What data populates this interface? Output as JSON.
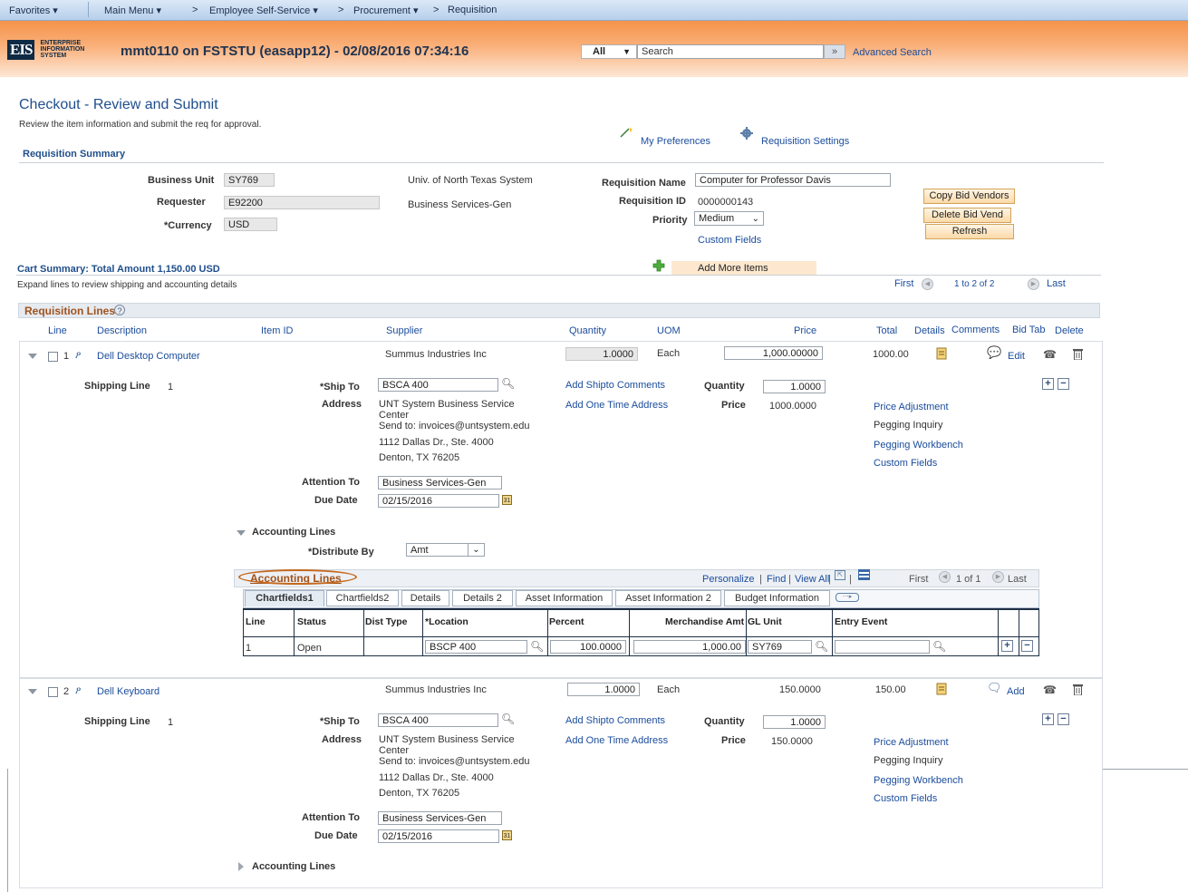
{
  "nav": {
    "favorites": "Favorites",
    "main_menu": "Main Menu",
    "employee_self_service": "Employee Self-Service",
    "procurement": "Procurement",
    "requisition": "Requisition"
  },
  "header": {
    "logo_text": "EIS",
    "logo_line1": "ENTERPRISE",
    "logo_line2": "INFORMATION",
    "logo_line3": "SYSTEM",
    "title": "mmt0110 on FSTSTU (easapp12) - 02/08/2016 07:34:16",
    "search_scope": "All",
    "search_placeholder": "Search",
    "advanced_search": "Advanced Search"
  },
  "page": {
    "title": "Checkout - Review and Submit",
    "instructions": "Review the item information and submit the req for approval.",
    "my_preferences": "My Preferences",
    "requisition_settings": "Requisition Settings",
    "summary_heading": "Requisition Summary"
  },
  "summary": {
    "business_unit_label": "Business Unit",
    "business_unit": "SY769",
    "business_unit_desc": "Univ. of North Texas System",
    "requester_label": "Requester",
    "requester": "E92200",
    "requester_desc": "Business Services-Gen",
    "currency_label": "*Currency",
    "currency": "USD",
    "req_name_label": "Requisition Name",
    "req_name": "Computer for Professor Davis",
    "req_id_label": "Requisition ID",
    "req_id": "0000000143",
    "priority_label": "Priority",
    "priority": "Medium",
    "custom_fields": "Custom Fields",
    "copy_bid_vendors": "Copy Bid Vendors",
    "delete_bid_vendors": "Delete Bid Vend",
    "refresh": "Refresh"
  },
  "cart": {
    "summary": "Cart Summary: Total Amount 1,150.00 USD",
    "expand_note": "Expand lines to review shipping and accounting details",
    "add_more_items": "Add More Items",
    "first": "First",
    "range": "1 to 2 of 2",
    "last": "Last"
  },
  "req_lines": {
    "heading": "Requisition Lines",
    "columns": {
      "line": "Line",
      "description": "Description",
      "item_id": "Item ID",
      "supplier": "Supplier",
      "quantity": "Quantity",
      "uom": "UOM",
      "price": "Price",
      "total": "Total",
      "details": "Details",
      "comments": "Comments",
      "bid_tab": "Bid Tab",
      "delete": "Delete"
    },
    "lines": [
      {
        "num": "1",
        "description": "Dell Desktop Computer",
        "supplier": "Summus Industries Inc",
        "quantity": "1.0000",
        "uom": "Each",
        "price": "1,000.00000",
        "total": "1000.00",
        "comment_action": "Edit",
        "shipping_line_label": "Shipping Line",
        "shipping_line": "1",
        "ship_to_label": "*Ship To",
        "ship_to": "BSCA 400",
        "address_label": "Address",
        "address_1": "UNT System Business Service",
        "address_2": "Center",
        "address_3": "Send to: invoices@untsystem.edu",
        "address_4": "1112 Dallas Dr., Ste. 4000",
        "address_5": "Denton, TX  76205",
        "add_shipto_comments": "Add Shipto Comments",
        "add_one_time_address": "Add One Time Address",
        "ship_qty_label": "Quantity",
        "ship_qty": "1.0000",
        "ship_price_label": "Price",
        "ship_price": "1000.0000",
        "price_adjustment": "Price Adjustment",
        "pegging_inquiry": "Pegging Inquiry",
        "pegging_workbench": "Pegging Workbench",
        "custom_fields": "Custom Fields",
        "attention_label": "Attention To",
        "attention": "Business Services-Gen",
        "due_date_label": "Due Date",
        "due_date": "02/15/2016",
        "accounting_lines": "Accounting Lines"
      },
      {
        "num": "2",
        "description": "Dell Keyboard",
        "supplier": "Summus Industries Inc",
        "quantity": "1.0000",
        "uom": "Each",
        "price": "150.0000",
        "total": "150.00",
        "comment_action": "Add",
        "shipping_line_label": "Shipping Line",
        "shipping_line": "1",
        "ship_to_label": "*Ship To",
        "ship_to": "BSCA 400",
        "address_label": "Address",
        "address_1": "UNT System Business Service",
        "address_2": "Center",
        "address_3": "Send to: invoices@untsystem.edu",
        "address_4": "1112 Dallas Dr., Ste. 4000",
        "address_5": "Denton, TX  76205",
        "add_shipto_comments": "Add Shipto Comments",
        "add_one_time_address": "Add One Time Address",
        "ship_qty_label": "Quantity",
        "ship_qty": "1.0000",
        "ship_price_label": "Price",
        "ship_price": "150.0000",
        "price_adjustment": "Price Adjustment",
        "pegging_inquiry": "Pegging Inquiry",
        "pegging_workbench": "Pegging Workbench",
        "custom_fields": "Custom Fields",
        "attention_label": "Attention To",
        "attention": "Business Services-Gen",
        "due_date_label": "Due Date",
        "due_date": "02/15/2016",
        "accounting_lines": "Accounting Lines"
      }
    ]
  },
  "accounting": {
    "distribute_by_label": "*Distribute By",
    "distribute_by": "Amt",
    "grid_title": "Accounting Lines",
    "personalize": "Personalize",
    "find": "Find",
    "view_all": "View All",
    "first": "First",
    "range": "1 of 1",
    "last": "Last",
    "tabs": [
      "Chartfields1",
      "Chartfields2",
      "Details",
      "Details 2",
      "Asset Information",
      "Asset Information 2",
      "Budget Information"
    ],
    "columns": {
      "line": "Line",
      "status": "Status",
      "dist_type": "Dist Type",
      "location": "*Location",
      "percent": "Percent",
      "merch_amt": "Merchandise Amt",
      "gl_unit": "GL Unit",
      "entry_event": "Entry Event"
    },
    "row": {
      "line": "1",
      "status": "Open",
      "location": "BSCP  400",
      "percent": "100.0000",
      "merch_amt": "1,000.00",
      "gl_unit": "SY769"
    }
  },
  "colors": {
    "header_orange": "#f59a4d",
    "nav_blue": "#bfd5ee",
    "link_blue": "#1a4c9c",
    "title_blue": "#1f4e8c",
    "annotation_circle": "#c5691e"
  }
}
